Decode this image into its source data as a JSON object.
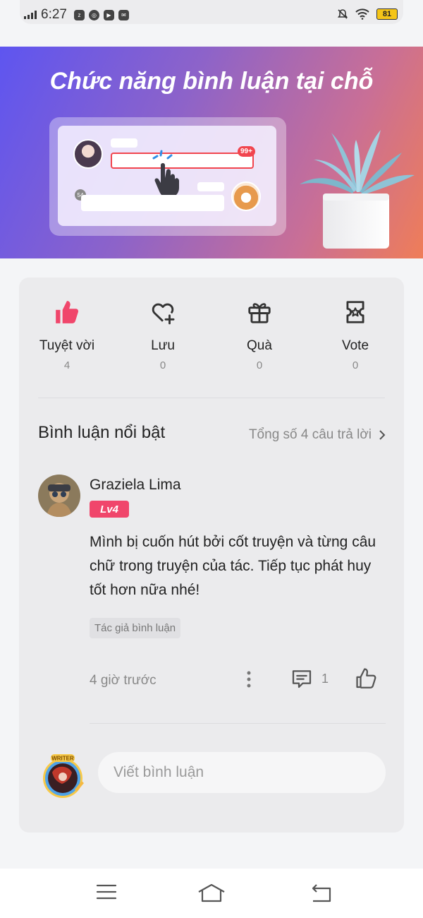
{
  "status_bar": {
    "time": "6:27",
    "battery": "81",
    "app_icons": [
      "zalo-icon",
      "chrome-icon",
      "youtube-icon",
      "gmail-icon"
    ]
  },
  "banner": {
    "title": "Chức năng bình luận tại chỗ",
    "mock_badge": "99+",
    "mock_count": "54"
  },
  "actions": [
    {
      "label": "Tuyệt vời",
      "count": "4",
      "icon": "thumbs-up-icon",
      "color": "#f0466b"
    },
    {
      "label": "Lưu",
      "count": "0",
      "icon": "heart-plus-icon"
    },
    {
      "label": "Quà",
      "count": "0",
      "icon": "gift-icon"
    },
    {
      "label": "Vote",
      "count": "0",
      "icon": "vote-ticket-icon"
    }
  ],
  "featured": {
    "title": "Bình luận nổi bật",
    "total_link": "Tổng số 4 câu trả lời"
  },
  "comment": {
    "author": "Graziela Lima",
    "level": "Lv4",
    "text": "Mình bị cuốn hút bởi cốt truyện và từng câu chữ trong truyện của tác. Tiếp tục phát huy tốt hơn nữa nhé!",
    "tag": "Tác giả bình luận",
    "time": "4 giờ trước",
    "reply_count": "1"
  },
  "composer": {
    "placeholder": "Viết bình luận",
    "avatar_badge": "WRITER"
  },
  "colors": {
    "accent": "#f0466b",
    "banner_start": "#5e55f0",
    "banner_end": "#ef7d58"
  }
}
